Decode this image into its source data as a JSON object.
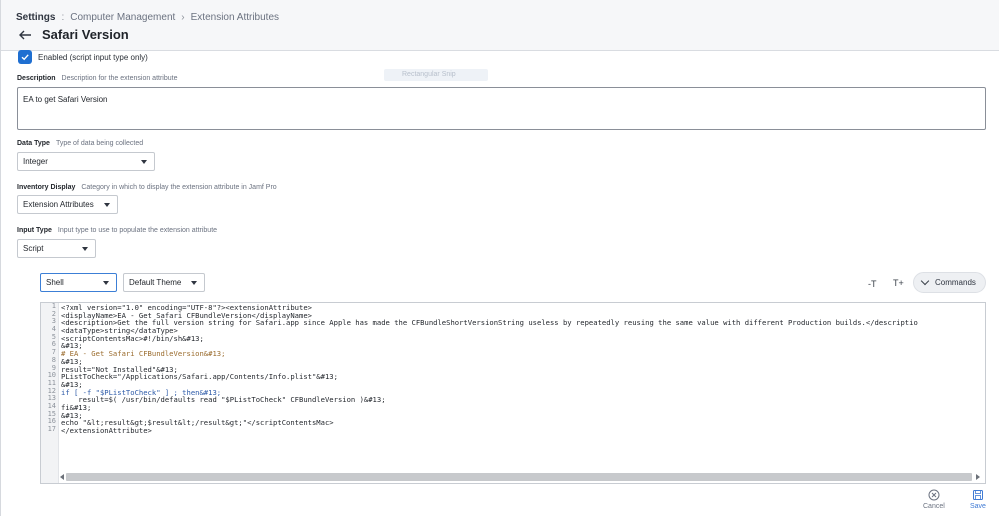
{
  "breadcrumb": {
    "root": "Settings",
    "sep1": ":",
    "item1": "Computer Management",
    "sep2": "›",
    "item2": "Extension Attributes"
  },
  "page_title": "Safari Version",
  "enabled": {
    "label": "Enabled (script input type only)",
    "checked": true
  },
  "ghost_chip": "Rectangular Snip",
  "description": {
    "label": "Description",
    "hint": "Description for the extension attribute",
    "value": "EA to get Safari Version"
  },
  "data_type": {
    "label": "Data Type",
    "hint": "Type of data being collected",
    "value": "Integer"
  },
  "inventory_display": {
    "label": "Inventory Display",
    "hint": "Category in which to display the extension attribute in Jamf Pro",
    "value": "Extension Attributes"
  },
  "input_type": {
    "label": "Input Type",
    "hint": "Input type to use to populate the extension attribute",
    "value": "Script"
  },
  "editor": {
    "language": "Shell",
    "theme": "Default Theme",
    "font_decrease": "-T",
    "font_increase": "T+",
    "commands_label": "Commands",
    "line_numbers": [
      "1",
      "2",
      "3",
      "4",
      "5",
      "6",
      "7",
      "8",
      "9",
      "10",
      "11",
      "12",
      "13",
      "14",
      "15",
      "16",
      "17"
    ],
    "lines": [
      "<?xml version=\"1.0\" encoding=\"UTF-8\"?><extensionAttribute>",
      "<displayName>EA - Get Safari CFBundleVersion</displayName>",
      "<description>Get the full version string for Safari.app since Apple has made the CFBundleShortVersionString useless by repeatedly reusing the same value with different Production builds.</descriptio",
      "<dataType>string</dataType>",
      "<scriptContentsMac>#!/bin/sh&#13;",
      "&#13;",
      "# EA - Get Safari CFBundleVersion&#13;",
      "&#13;",
      "result=\"Not Installed\"&#13;",
      "PListToCheck=\"/Applications/Safari.app/Contents/Info.plist\"&#13;",
      "&#13;",
      "if [ -f \"$PListToCheck\" ] ; then&#13;",
      "    result=$( /usr/bin/defaults read \"$PListToCheck\" CFBundleVersion )&#13;",
      "fi&#13;",
      "&#13;",
      "echo \"&lt;result&gt;$result&lt;/result&gt;\"</scriptContentsMac>",
      "</extensionAttribute>"
    ]
  },
  "footer": {
    "cancel": "Cancel",
    "save": "Save"
  },
  "colors": {
    "accent": "#1f6fd1",
    "save": "#3f7ad4"
  }
}
